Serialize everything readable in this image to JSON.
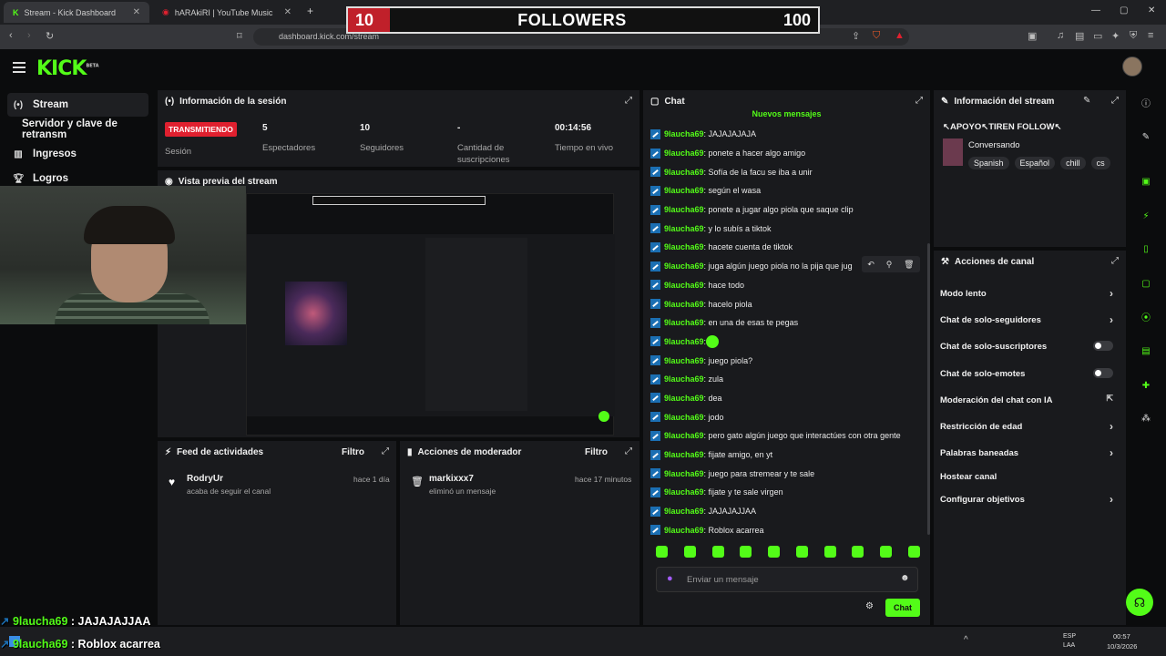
{
  "browser": {
    "tabs": [
      {
        "label": "Stream - Kick Dashboard",
        "active": true
      },
      {
        "label": "hARAkiRI | YouTube Music",
        "active": false
      }
    ],
    "new_tab": "+",
    "url": "dashboard.kick.com/stream"
  },
  "followers_goal": {
    "current": "10",
    "label": "FOLLOWERS",
    "goal": "100"
  },
  "header": {
    "logo": "KICK",
    "logo_sup": "BETA"
  },
  "sidebar": {
    "items": [
      {
        "label": "Stream",
        "icon": "stream-icon",
        "active": true
      },
      {
        "label": "Servidor y clave de retransm",
        "icon": "",
        "active": false
      },
      {
        "label": "Ingresos",
        "icon": "revenue-icon",
        "active": false
      },
      {
        "label": "Logros",
        "icon": "trophy-icon",
        "active": false
      }
    ]
  },
  "session": {
    "title": "Información de la sesión",
    "live_badge": "TRANSMITIENDO",
    "stats": [
      {
        "value": "",
        "label": "Sesión"
      },
      {
        "value": "5",
        "label": "Espectadores"
      },
      {
        "value": "10",
        "label": "Seguidores"
      },
      {
        "value": "-",
        "label": "Cantidad de suscripciones"
      },
      {
        "value": "00:14:56",
        "label": "Tiempo en vivo"
      }
    ]
  },
  "preview": {
    "title": "Vista previa del stream"
  },
  "feed": {
    "title": "Feed de actividades",
    "filter": "Filtro",
    "entries": [
      {
        "name": "RodryUr",
        "sub": "acaba de seguir el canal",
        "time": "hace 1 día"
      }
    ]
  },
  "mod": {
    "title": "Acciones de moderador",
    "filter": "Filtro",
    "entries": [
      {
        "name": "markixxx7",
        "sub": "eliminó un mensaje",
        "time": "hace 17 minutos"
      }
    ]
  },
  "chat": {
    "title": "Chat",
    "new_messages": "Nuevos mensajes",
    "messages": [
      {
        "user": "9laucha69",
        "text": ": JAJAJAJAJA"
      },
      {
        "user": "9laucha69",
        "text": ": ponete a hacer algo amigo"
      },
      {
        "user": "9laucha69",
        "text": ": Sofía de la facu se iba a unir"
      },
      {
        "user": "9laucha69",
        "text": ": según el wasa"
      },
      {
        "user": "9laucha69",
        "text": ": ponete a jugar algo piola que saque clip"
      },
      {
        "user": "9laucha69",
        "text": ": y lo subís a tiktok"
      },
      {
        "user": "9laucha69",
        "text": ": hacete cuenta de tiktok"
      },
      {
        "user": "9laucha69",
        "text": ": juga algún juego piola no la pija que jug"
      },
      {
        "user": "9laucha69",
        "text": ": hace todo"
      },
      {
        "user": "9laucha69",
        "text": ": hacelo piola"
      },
      {
        "user": "9laucha69",
        "text": ": en una de esas te pegas"
      },
      {
        "user": "9laucha69",
        "text": ": ",
        "emote": true
      },
      {
        "user": "9laucha69",
        "text": ": juego piola?"
      },
      {
        "user": "9laucha69",
        "text": ": zula"
      },
      {
        "user": "9laucha69",
        "text": ": dea"
      },
      {
        "user": "9laucha69",
        "text": ": jodo"
      },
      {
        "user": "9laucha69",
        "text": ": pero gato algún juego que interactúes con otra gente"
      },
      {
        "user": "9laucha69",
        "text": ": fijate amigo, en yt"
      },
      {
        "user": "9laucha69",
        "text": ": juego para stremear y te sale"
      },
      {
        "user": "9laucha69",
        "text": ": fijate y te sale virgen"
      },
      {
        "user": "9laucha69",
        "text": ": JAJAJAJJAA"
      },
      {
        "user": "9laucha69",
        "text": ": Roblox acarrea"
      }
    ],
    "input_placeholder": "Enviar un mensaje",
    "send_label": "Chat"
  },
  "stream_info": {
    "title": "Información del stream",
    "stream_title": "↖APOYO↖TIREN FOLLOW↖",
    "category": "Conversando",
    "tags": [
      "Spanish",
      "Español",
      "chill",
      "cs"
    ]
  },
  "channel_actions": {
    "title": "Acciones de canal",
    "items": [
      {
        "label": "Modo lento",
        "control": "chevron"
      },
      {
        "label": "Chat de solo-seguidores",
        "control": "chevron"
      },
      {
        "label": "Chat de solo-suscriptores",
        "control": "toggle"
      },
      {
        "label": "Chat de solo-emotes",
        "control": "toggle"
      },
      {
        "label": "Moderación del chat con IA",
        "control": "link"
      },
      {
        "label": "Restricción de edad",
        "control": "chevron"
      },
      {
        "label": "Palabras baneadas",
        "control": "chevron"
      },
      {
        "label": "Hostear canal",
        "control": "none"
      },
      {
        "label": "Configurar objetivos",
        "control": "chevron"
      }
    ]
  },
  "overlay_chat": [
    {
      "user": "9laucha69",
      "text": " : JAJAJAJJAA"
    },
    {
      "user": "9laucha69",
      "text": " : Roblox acarrea"
    }
  ],
  "taskbar": {
    "lang1": "ESP",
    "lang2": "LAA",
    "time": "00:57",
    "date": "10/3/2026"
  },
  "colors": {
    "accent": "#53fc18",
    "live": "#e0202f",
    "panel": "#191a1d",
    "bg": "#0b0c0d"
  }
}
